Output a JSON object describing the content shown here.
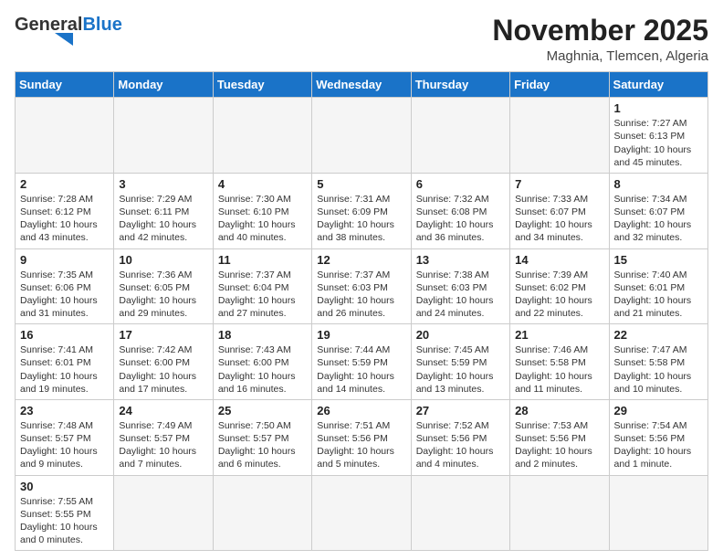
{
  "logo": {
    "text_general": "General",
    "text_blue": "Blue"
  },
  "title": "November 2025",
  "subtitle": "Maghnia, Tlemcen, Algeria",
  "days_of_week": [
    "Sunday",
    "Monday",
    "Tuesday",
    "Wednesday",
    "Thursday",
    "Friday",
    "Saturday"
  ],
  "weeks": [
    [
      {
        "day": "",
        "info": ""
      },
      {
        "day": "",
        "info": ""
      },
      {
        "day": "",
        "info": ""
      },
      {
        "day": "",
        "info": ""
      },
      {
        "day": "",
        "info": ""
      },
      {
        "day": "",
        "info": ""
      },
      {
        "day": "1",
        "info": "Sunrise: 7:27 AM\nSunset: 6:13 PM\nDaylight: 10 hours and 45 minutes."
      }
    ],
    [
      {
        "day": "2",
        "info": "Sunrise: 7:28 AM\nSunset: 6:12 PM\nDaylight: 10 hours and 43 minutes."
      },
      {
        "day": "3",
        "info": "Sunrise: 7:29 AM\nSunset: 6:11 PM\nDaylight: 10 hours and 42 minutes."
      },
      {
        "day": "4",
        "info": "Sunrise: 7:30 AM\nSunset: 6:10 PM\nDaylight: 10 hours and 40 minutes."
      },
      {
        "day": "5",
        "info": "Sunrise: 7:31 AM\nSunset: 6:09 PM\nDaylight: 10 hours and 38 minutes."
      },
      {
        "day": "6",
        "info": "Sunrise: 7:32 AM\nSunset: 6:08 PM\nDaylight: 10 hours and 36 minutes."
      },
      {
        "day": "7",
        "info": "Sunrise: 7:33 AM\nSunset: 6:07 PM\nDaylight: 10 hours and 34 minutes."
      },
      {
        "day": "8",
        "info": "Sunrise: 7:34 AM\nSunset: 6:07 PM\nDaylight: 10 hours and 32 minutes."
      }
    ],
    [
      {
        "day": "9",
        "info": "Sunrise: 7:35 AM\nSunset: 6:06 PM\nDaylight: 10 hours and 31 minutes."
      },
      {
        "day": "10",
        "info": "Sunrise: 7:36 AM\nSunset: 6:05 PM\nDaylight: 10 hours and 29 minutes."
      },
      {
        "day": "11",
        "info": "Sunrise: 7:37 AM\nSunset: 6:04 PM\nDaylight: 10 hours and 27 minutes."
      },
      {
        "day": "12",
        "info": "Sunrise: 7:37 AM\nSunset: 6:03 PM\nDaylight: 10 hours and 26 minutes."
      },
      {
        "day": "13",
        "info": "Sunrise: 7:38 AM\nSunset: 6:03 PM\nDaylight: 10 hours and 24 minutes."
      },
      {
        "day": "14",
        "info": "Sunrise: 7:39 AM\nSunset: 6:02 PM\nDaylight: 10 hours and 22 minutes."
      },
      {
        "day": "15",
        "info": "Sunrise: 7:40 AM\nSunset: 6:01 PM\nDaylight: 10 hours and 21 minutes."
      }
    ],
    [
      {
        "day": "16",
        "info": "Sunrise: 7:41 AM\nSunset: 6:01 PM\nDaylight: 10 hours and 19 minutes."
      },
      {
        "day": "17",
        "info": "Sunrise: 7:42 AM\nSunset: 6:00 PM\nDaylight: 10 hours and 17 minutes."
      },
      {
        "day": "18",
        "info": "Sunrise: 7:43 AM\nSunset: 6:00 PM\nDaylight: 10 hours and 16 minutes."
      },
      {
        "day": "19",
        "info": "Sunrise: 7:44 AM\nSunset: 5:59 PM\nDaylight: 10 hours and 14 minutes."
      },
      {
        "day": "20",
        "info": "Sunrise: 7:45 AM\nSunset: 5:59 PM\nDaylight: 10 hours and 13 minutes."
      },
      {
        "day": "21",
        "info": "Sunrise: 7:46 AM\nSunset: 5:58 PM\nDaylight: 10 hours and 11 minutes."
      },
      {
        "day": "22",
        "info": "Sunrise: 7:47 AM\nSunset: 5:58 PM\nDaylight: 10 hours and 10 minutes."
      }
    ],
    [
      {
        "day": "23",
        "info": "Sunrise: 7:48 AM\nSunset: 5:57 PM\nDaylight: 10 hours and 9 minutes."
      },
      {
        "day": "24",
        "info": "Sunrise: 7:49 AM\nSunset: 5:57 PM\nDaylight: 10 hours and 7 minutes."
      },
      {
        "day": "25",
        "info": "Sunrise: 7:50 AM\nSunset: 5:57 PM\nDaylight: 10 hours and 6 minutes."
      },
      {
        "day": "26",
        "info": "Sunrise: 7:51 AM\nSunset: 5:56 PM\nDaylight: 10 hours and 5 minutes."
      },
      {
        "day": "27",
        "info": "Sunrise: 7:52 AM\nSunset: 5:56 PM\nDaylight: 10 hours and 4 minutes."
      },
      {
        "day": "28",
        "info": "Sunrise: 7:53 AM\nSunset: 5:56 PM\nDaylight: 10 hours and 2 minutes."
      },
      {
        "day": "29",
        "info": "Sunrise: 7:54 AM\nSunset: 5:56 PM\nDaylight: 10 hours and 1 minute."
      }
    ],
    [
      {
        "day": "30",
        "info": "Sunrise: 7:55 AM\nSunset: 5:55 PM\nDaylight: 10 hours and 0 minutes."
      },
      {
        "day": "",
        "info": ""
      },
      {
        "day": "",
        "info": ""
      },
      {
        "day": "",
        "info": ""
      },
      {
        "day": "",
        "info": ""
      },
      {
        "day": "",
        "info": ""
      },
      {
        "day": "",
        "info": ""
      }
    ]
  ]
}
